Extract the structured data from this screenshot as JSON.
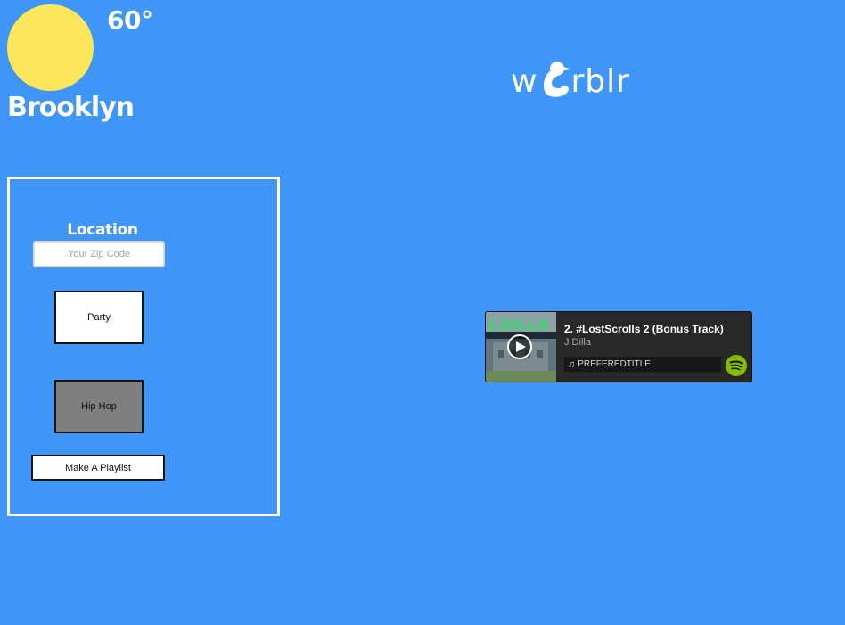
{
  "weather": {
    "temperature": "60°",
    "city": "Brooklyn",
    "icon": "sun-icon",
    "sun_color": "#fce659"
  },
  "logo": {
    "prefix": "w",
    "suffix": "rblr",
    "icon": "bird-icon"
  },
  "form": {
    "location_label": "Location",
    "zip_placeholder": "Your Zip Code",
    "zip_value": "",
    "option_party": "Party",
    "option_hiphop": "Hip Hop",
    "make_playlist": "Make A Playlist"
  },
  "player": {
    "track_title": "2. #LostScrolls 2 (Bonus Track)",
    "artist": "J Dilla",
    "preferred_title": "PREFEREDTITLE",
    "cover_text": "J.DILLA",
    "icons": [
      "play-icon",
      "music-note-icon",
      "spotify-icon"
    ]
  },
  "colors": {
    "background": "#4096f7",
    "panel_border": "#ffffff",
    "selected_option": "#7f7f7f",
    "spotify_green": "#84bd00"
  }
}
